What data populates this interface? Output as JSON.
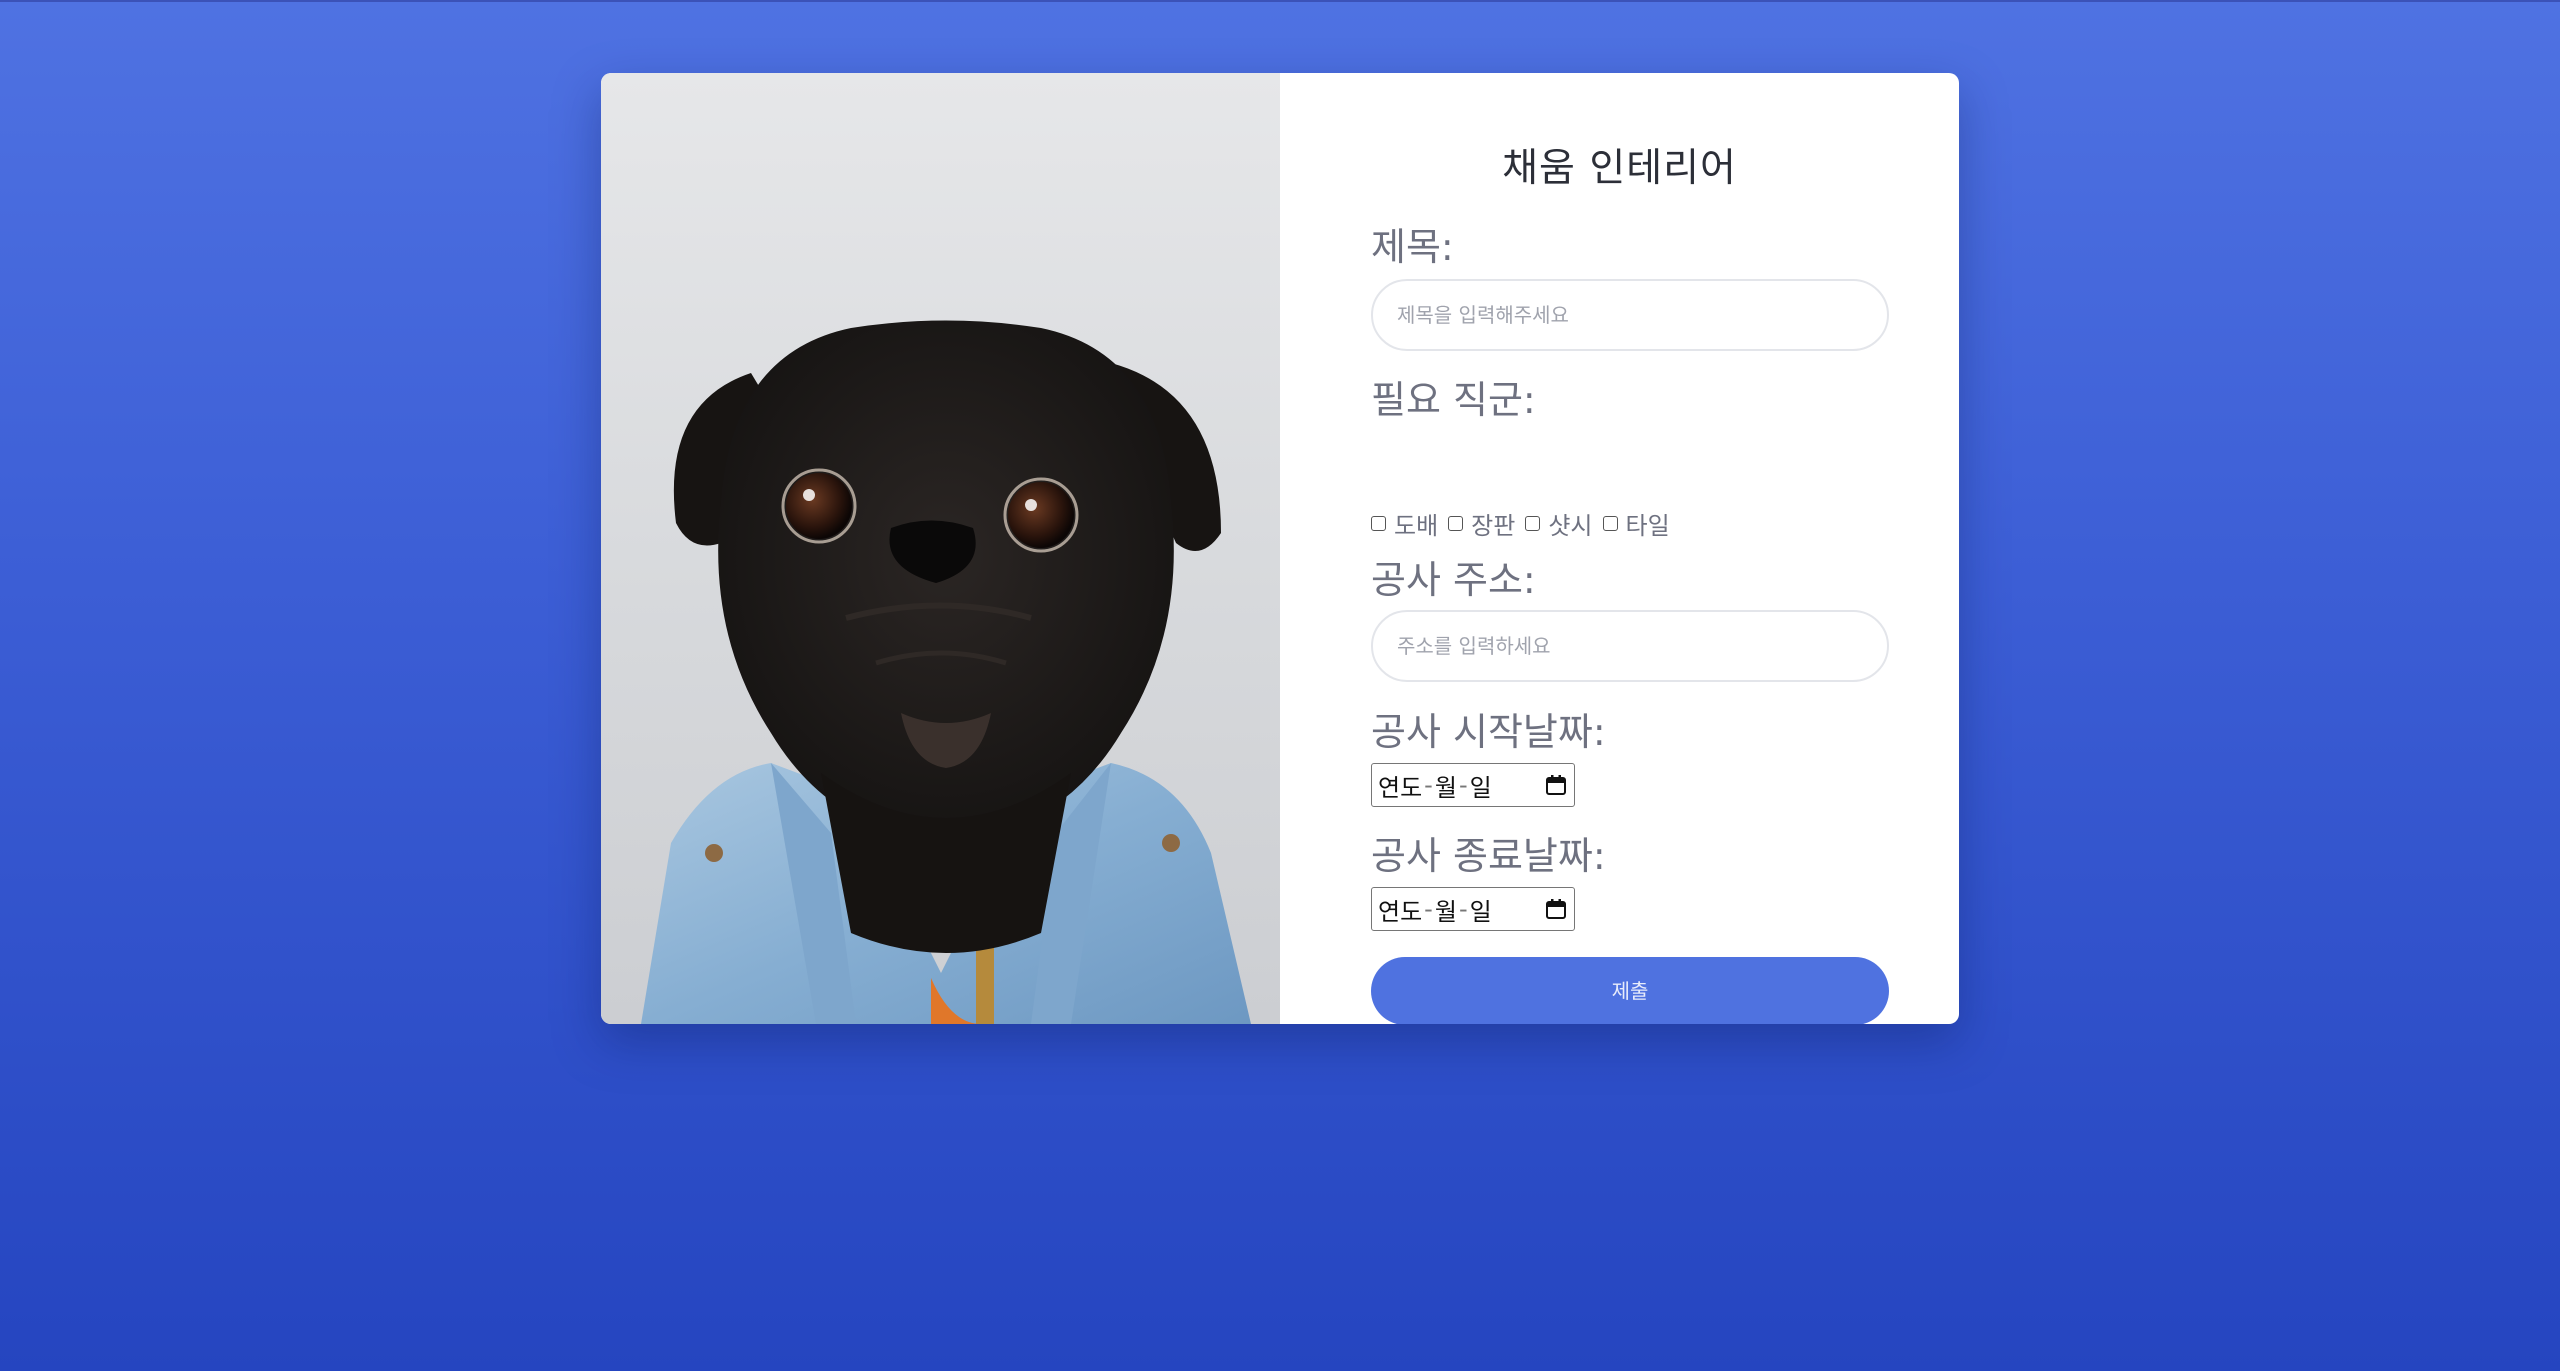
{
  "form": {
    "title": "채움 인테리어",
    "subject_label": "제목:",
    "subject_placeholder": "제목을 입력해주세요",
    "roles_label": "필요 직군:",
    "roles": [
      "도배",
      "장판",
      "샷시",
      "타일"
    ],
    "address_label": "공사 주소:",
    "address_placeholder": "주소를 입력하세요",
    "start_label": "공사 시작날짜:",
    "end_label": "공사 종료날짜:",
    "date_parts": [
      "연도",
      "월",
      "일"
    ],
    "date_separator": "-",
    "submit_label": "제출"
  },
  "icons": {
    "date_picker": "calendar-icon"
  },
  "colors": {
    "background_top": "#4f72e2",
    "background_bottom": "#2545c0",
    "accent": "#4f72e0"
  }
}
